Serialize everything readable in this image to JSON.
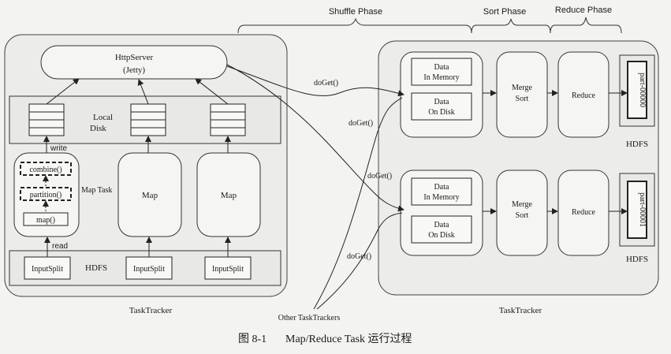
{
  "phases": {
    "shuffle": "Shuffle Phase",
    "sort": "Sort Phase",
    "reduce": "Reduce Phase"
  },
  "left_tracker": {
    "label": "TaskTracker",
    "http_server_line1": "HttpServer",
    "http_server_line2": "(Jetty)",
    "local_disk_line1": "Local",
    "local_disk_line2": "Disk",
    "write_label": "write",
    "read_label": "read",
    "map_task_label": "Map Task",
    "combine": "combine()",
    "partition": "partition()",
    "map_fn": "map()",
    "map_label_2": "Map",
    "map_label_3": "Map",
    "hdfs_label": "HDFS",
    "input_split_1": "InputSplit",
    "input_split_2": "InputSplit",
    "input_split_3": "InputSplit"
  },
  "right_tracker": {
    "label": "TaskTracker",
    "reducers": [
      {
        "data_mem_line1": "Data",
        "data_mem_line2": "In Memory",
        "data_disk_line1": "Data",
        "data_disk_line2": "On Disk",
        "merge_line1": "Merge",
        "merge_line2": "Sort",
        "reduce": "Reduce",
        "part": "part-00000",
        "hdfs": "HDFS"
      },
      {
        "data_mem_line1": "Data",
        "data_mem_line2": "In Memory",
        "data_disk_line1": "Data",
        "data_disk_line2": "On Disk",
        "merge_line1": "Merge",
        "merge_line2": "Sort",
        "reduce": "Reduce",
        "part": "part-00001",
        "hdfs": "HDFS"
      }
    ]
  },
  "doget_labels": [
    "doGet()",
    "doGet()",
    "doGet()",
    "doGet()"
  ],
  "other_tasktrackers": "Other TaskTrackers",
  "caption": {
    "number": "图 8-1",
    "text": "Map/Reduce Task 运行过程"
  }
}
